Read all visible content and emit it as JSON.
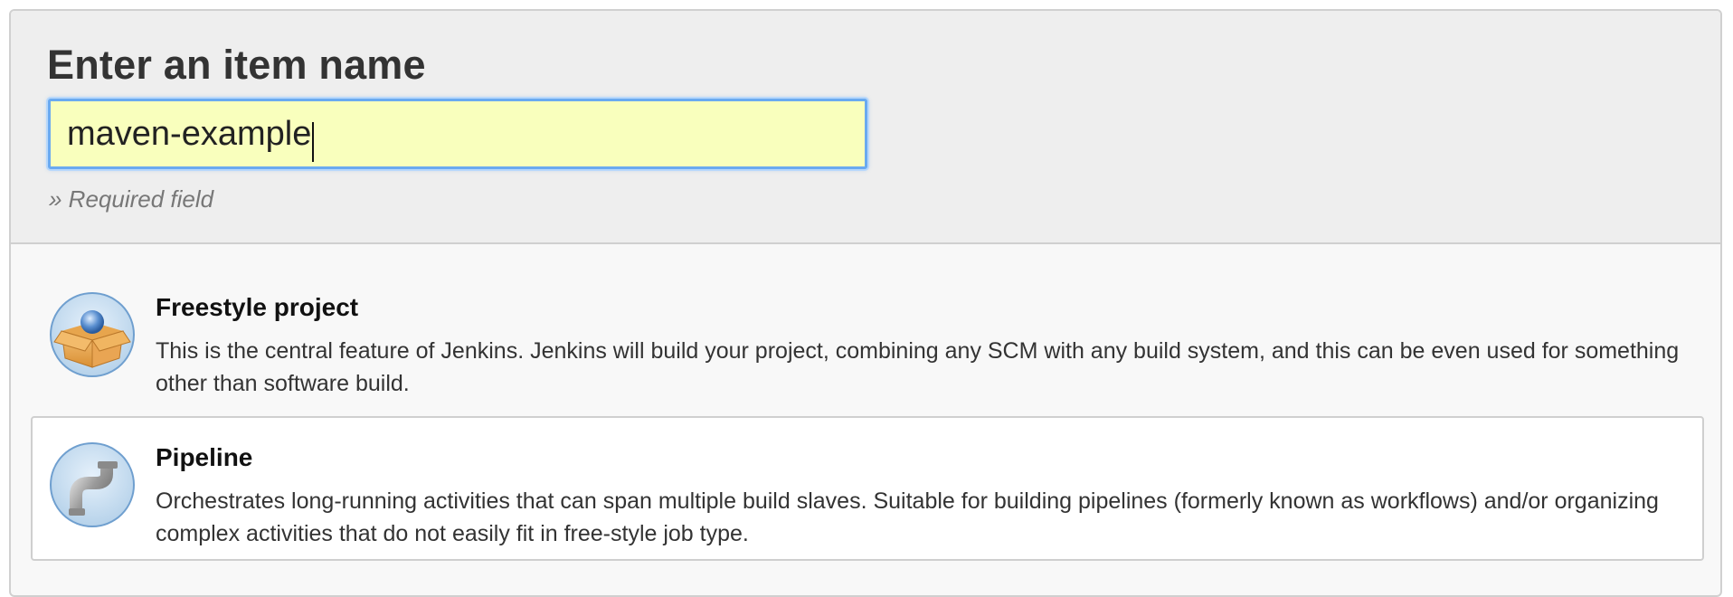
{
  "header": {
    "title": "Enter an item name",
    "input_value": "maven-example",
    "required_note": "» Required field"
  },
  "item_types": [
    {
      "name": "Freestyle project",
      "description": "This is the central feature of Jenkins. Jenkins will build your project, combining any SCM with any build system, and this can be even used for something other than software build.",
      "icon": "freestyle-box-icon"
    },
    {
      "name": "Pipeline",
      "description": "Orchestrates long-running activities that can span multiple build slaves. Suitable for building pipelines (formerly known as workflows) and/or organizing complex activities that do not easily fit in free-style job type.",
      "icon": "pipeline-icon"
    }
  ],
  "colors": {
    "input_background": "#f9ffbd",
    "focus_ring": "#6aaaf0",
    "header_background": "#eeeeee",
    "list_background": "#f8f8f8"
  }
}
